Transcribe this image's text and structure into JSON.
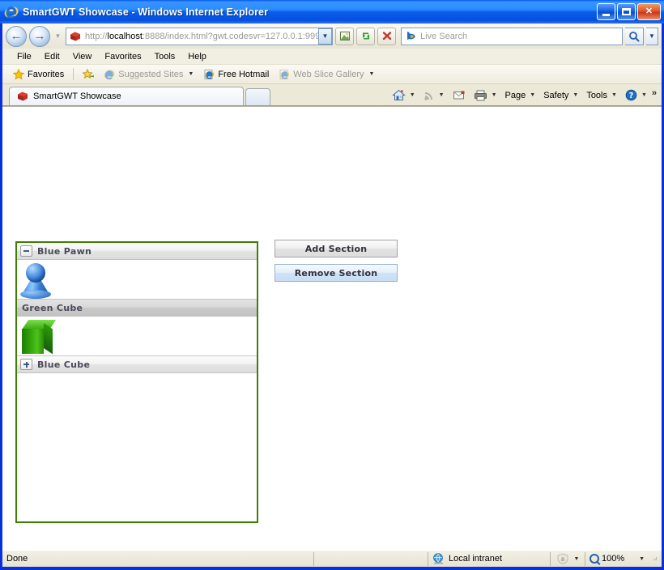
{
  "window": {
    "title": "SmartGWT Showcase - Windows Internet Explorer",
    "app_icon": "internet-explorer-icon",
    "minimize_label": "Minimize",
    "maximize_label": "Maximize",
    "close_label": "Close"
  },
  "nav": {
    "back_label": "Back",
    "forward_label": "Forward",
    "history_label": "Recent Pages",
    "url_protocol": "http://",
    "url_host": "localhost",
    "url_rest": ":8888/index.html?gwt.codesvr=127.0.0.1:999",
    "url_full": "http://localhost:8888/index.html?gwt.codesvr=127.0.0.1:999",
    "compat_label": "Compatibility View",
    "refresh_label": "Refresh",
    "stop_label": "Stop",
    "search_placeholder": "Live Search",
    "search_value": "",
    "search_provider": "bing-icon"
  },
  "menubar": {
    "items": [
      {
        "label": "File"
      },
      {
        "label": "Edit"
      },
      {
        "label": "View"
      },
      {
        "label": "Favorites"
      },
      {
        "label": "Tools"
      },
      {
        "label": "Help"
      }
    ]
  },
  "favbar": {
    "favorites_label": "Favorites",
    "add_to_favbar_label": "Add to Favorites Bar",
    "items": [
      {
        "label": "Suggested Sites",
        "icon": "ie-page-icon",
        "has_caret": true,
        "dim": true
      },
      {
        "label": "Free Hotmail",
        "icon": "ie-page-icon",
        "has_caret": false,
        "dim": false
      },
      {
        "label": "Web Slice Gallery",
        "icon": "ie-page-icon",
        "has_caret": true,
        "dim": true
      }
    ]
  },
  "tabbar": {
    "tabs": [
      {
        "label": "SmartGWT Showcase",
        "icon": "smartgwt-icon",
        "active": true
      }
    ],
    "new_tab_label": "New Tab",
    "tools": [
      {
        "label": "",
        "icon": "home-icon",
        "caret": true,
        "dim": false
      },
      {
        "label": "",
        "icon": "feeds-icon",
        "caret": true,
        "dim": true
      },
      {
        "label": "",
        "icon": "read-mail-icon",
        "caret": false,
        "dim": false
      },
      {
        "label": "",
        "icon": "print-icon",
        "caret": true,
        "dim": false
      },
      {
        "label": "Page",
        "icon": "",
        "caret": true,
        "dim": false
      },
      {
        "label": "Safety",
        "icon": "",
        "caret": true,
        "dim": false
      },
      {
        "label": "Tools",
        "icon": "",
        "caret": true,
        "dim": false
      },
      {
        "label": "",
        "icon": "help-icon",
        "caret": true,
        "dim": false
      }
    ],
    "overflow_label": "»"
  },
  "page": {
    "section_stack": {
      "border_color": "#3f7f00",
      "sections": [
        {
          "title": "Blue Pawn",
          "toggle": "minus",
          "expanded": true,
          "selected": false,
          "content_icon": "blue-pawn-icon"
        },
        {
          "title": "Green Cube",
          "toggle": "none",
          "expanded": true,
          "selected": true,
          "content_icon": "green-cube-icon"
        },
        {
          "title": "Blue Cube",
          "toggle": "plus",
          "expanded": false,
          "selected": false,
          "content_icon": "blue-cube-icon"
        }
      ]
    },
    "buttons": {
      "add_section": "Add Section",
      "remove_section": "Remove Section"
    }
  },
  "statusbar": {
    "status": "Done",
    "zone_label": "Local intranet",
    "zone_icon": "globe-icon",
    "protected_mode_icon": "shield-icon",
    "zoom_level": "100%",
    "zoom_icon": "zoom-icon"
  }
}
